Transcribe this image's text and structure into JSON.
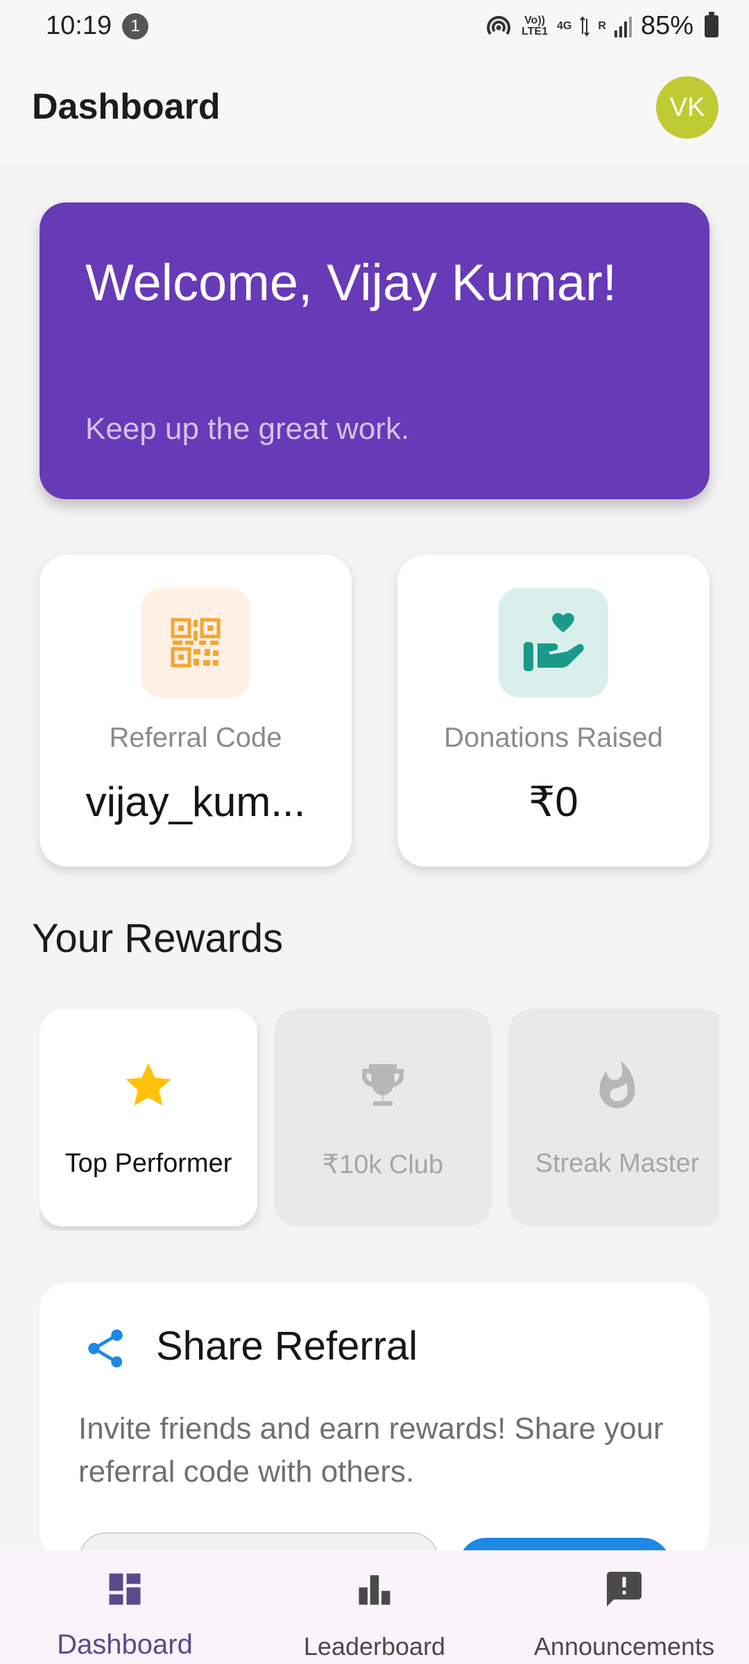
{
  "status_bar": {
    "time": "10:19",
    "notification_count": "1",
    "network_volte": "Vo)) LTE1",
    "network_type": "4G",
    "signal_r": "R",
    "battery": "85%"
  },
  "header": {
    "title": "Dashboard",
    "avatar_initials": "VK"
  },
  "welcome": {
    "title": "Welcome, Vijay Kumar!",
    "subtitle": "Keep up the great work."
  },
  "stats": [
    {
      "label": "Referral Code",
      "value": "vijay_kum...",
      "icon": "qr-code-icon",
      "icon_color": "#f7a531",
      "icon_bg": "#fff0e3"
    },
    {
      "label": "Donations Raised",
      "value": "₹0",
      "icon": "hand-heart-icon",
      "icon_color": "#1a9a8a",
      "icon_bg": "#d9efec"
    }
  ],
  "rewards": {
    "title": "Your Rewards",
    "items": [
      {
        "label": "Top Performer",
        "icon": "star-icon",
        "state": "unlocked",
        "color": "#ffc107"
      },
      {
        "label": "₹10k Club",
        "icon": "trophy-icon",
        "state": "locked",
        "color": "#b7b7b7"
      },
      {
        "label": "Streak Master",
        "icon": "flame-icon",
        "state": "locked",
        "color": "#b7b7b7"
      }
    ]
  },
  "share": {
    "title": "Share Referral",
    "description": "Invite friends and earn rewards! Share your referral code with others.",
    "accent": "#1e88e5"
  },
  "bottom_nav": {
    "items": [
      {
        "label": "Dashboard",
        "icon": "dashboard-icon",
        "active": true
      },
      {
        "label": "Leaderboard",
        "icon": "leaderboard-icon",
        "active": false
      },
      {
        "label": "Announcements",
        "icon": "announcement-icon",
        "active": false
      }
    ]
  },
  "colors": {
    "primary": "#673ab7",
    "avatar": "#c0ca33",
    "background": "#f4f4f4"
  }
}
